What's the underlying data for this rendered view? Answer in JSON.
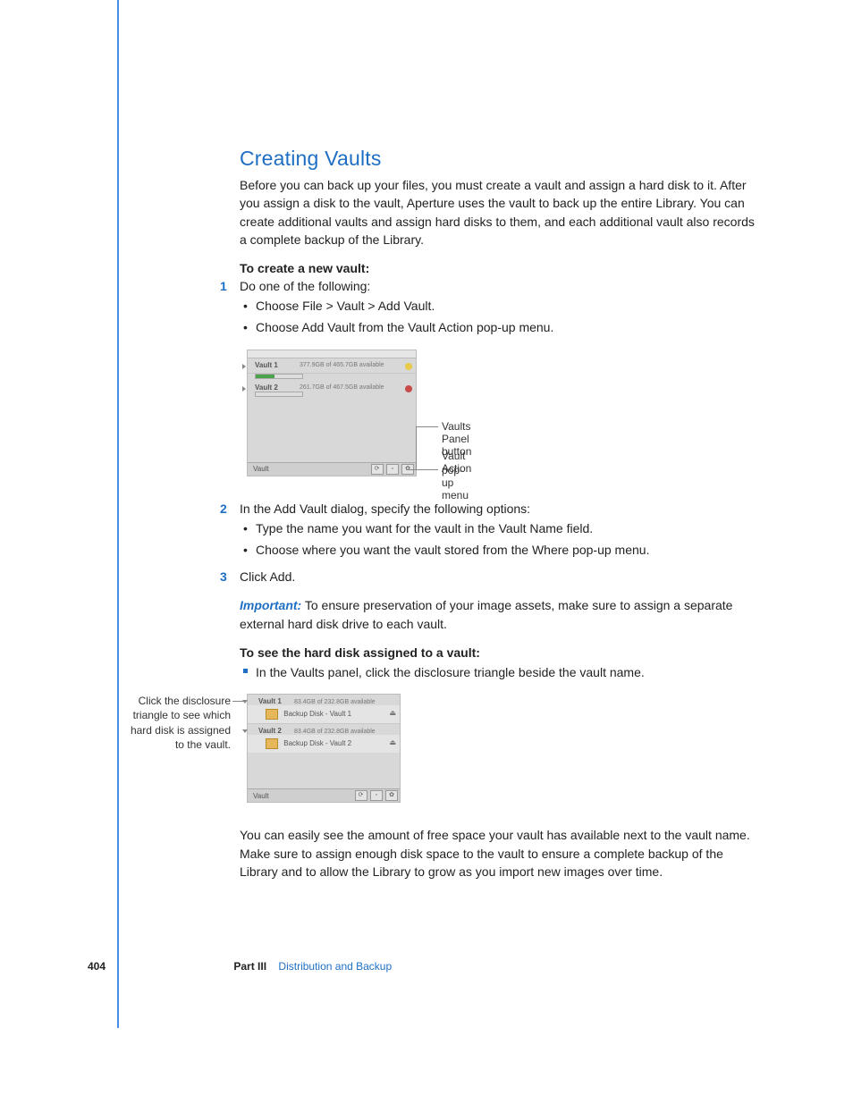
{
  "title": "Creating Vaults",
  "intro": "Before you can back up your files, you must create a vault and assign a hard disk to it. After you assign a disk to the vault, Aperture uses the vault to back up the entire Library. You can create additional vaults and assign hard disks to them, and each additional vault also records a complete backup of the Library.",
  "subhead1": "To create a new vault:",
  "step1_num": "1",
  "step1_text": "Do one of the following:",
  "step1_bullets": {
    "b1": "Choose File > Vault > Add Vault.",
    "b2": "Choose Add Vault from the Vault Action pop-up menu."
  },
  "fig1": {
    "vault1_name": "Vault 1",
    "vault1_info": "377.9GB of 465.7GB available",
    "vault2_name": "Vault 2",
    "vault2_info": "261.7GB of 467.5GB available",
    "footer_label": "Vault",
    "callout1": "Vaults Panel button",
    "callout2a": "Vault Action",
    "callout2b": "pop-up menu"
  },
  "step2_num": "2",
  "step2_text": "In the Add Vault dialog, specify the following options:",
  "step2_bullets": {
    "b1": "Type the name you want for the vault in the Vault Name field.",
    "b2": "Choose where you want the vault stored from the Where pop-up menu."
  },
  "step3_num": "3",
  "step3_text": "Click Add.",
  "important_label": "Important:",
  "important_text": "  To ensure preservation of your image assets, make sure to assign a separate external hard disk drive to each vault.",
  "subhead2": "To see the hard disk assigned to a vault:",
  "sq_bullet": "In the Vaults panel, click the disclosure triangle beside the vault name.",
  "fig2": {
    "caption": "Click the disclosure triangle to see which hard disk is assigned to the vault.",
    "v1_name": "Vault 1",
    "v1_info": "83.4GB of 232.8GB available",
    "disk1": "Backup Disk - Vault 1",
    "v2_name": "Vault 2",
    "v2_info": "83.4GB of 232.8GB available",
    "disk2": "Backup Disk - Vault 2",
    "footer_label": "Vault"
  },
  "closing": "You can easily see the amount of free space your vault has available next to the vault name. Make sure to assign enough disk space to the vault to ensure a complete backup of the Library and to allow the Library to grow as you import new images over time.",
  "footer": {
    "page_num": "404",
    "part": "Part III",
    "section": "Distribution and Backup"
  }
}
